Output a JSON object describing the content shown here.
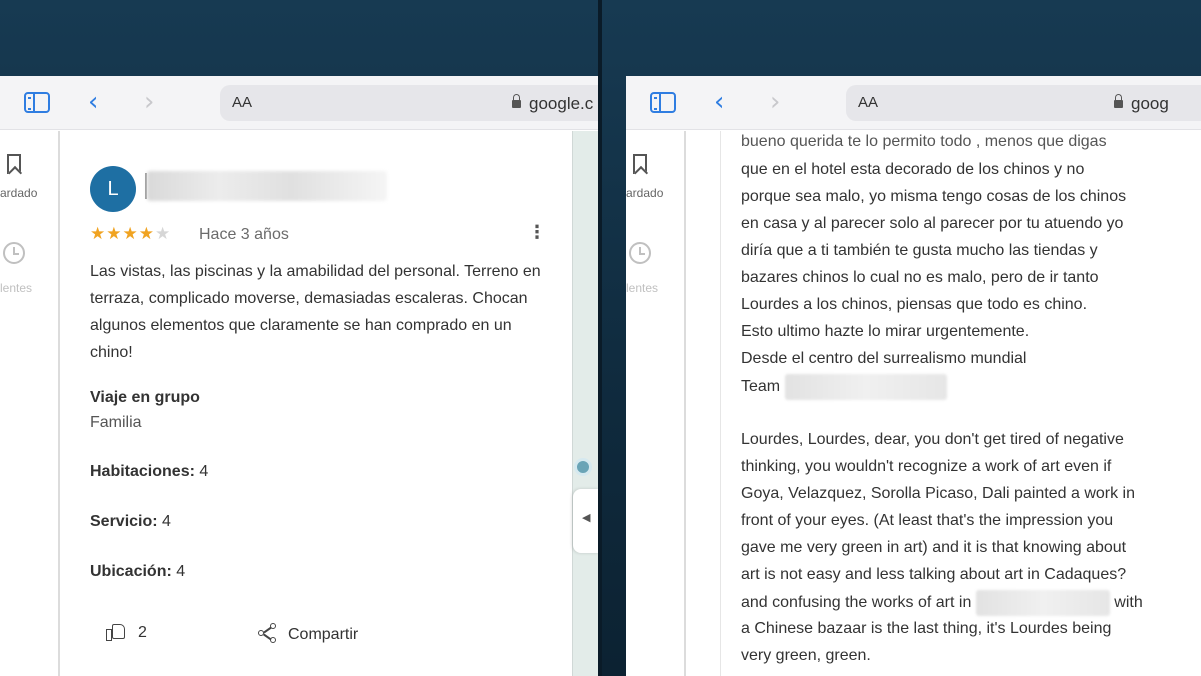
{
  "browser": {
    "text_size_label": "AA",
    "url": "google.c",
    "url_right": "goog"
  },
  "rail": {
    "saved_label": "ardado",
    "recents_label": "lentes"
  },
  "review": {
    "avatar_letter": "L",
    "rating": 4,
    "max_rating": 5,
    "date": "Hace 3 años",
    "text": "Las vistas, las piscinas y la amabilidad del personal. Terreno en terraza, complicado moverse, demasiadas escaleras. Chocan algunos elementos que claramente se han comprado en un chino!",
    "trip_type_label": "Viaje en grupo",
    "trip_type_value": "Familia",
    "rooms_label": "Habitaciones:",
    "rooms_value": "4",
    "service_label": "Servicio:",
    "service_value": "4",
    "location_label": "Ubicación:",
    "location_value": "4",
    "likes": "2",
    "share_label": "Compartir"
  },
  "reply": {
    "lines": [
      "bueno querida te lo permito todo , menos que digas",
      "que en el hotel esta decorado de los chinos y no",
      "porque sea malo, yo misma tengo cosas de los chinos",
      "en casa y al parecer solo al parecer por tu atuendo yo",
      "diría que a ti también te gusta mucho las tiendas y",
      "bazares chinos lo cual no es malo, pero de ir tanto",
      "Lourdes a los chinos, piensas que todo es chino.",
      "Esto ultimo  hazte lo mirar urgentemente.",
      "Desde el centro del surrealismo mundial",
      "Team",
      "Lourdes, Lourdes, dear, you don't get tired of negative",
      "thinking, you wouldn't recognize a work of art even if",
      "Goya, Velazquez, Sorolla Picaso, Dali painted a work in",
      "front of your eyes. (At least that's the impression you",
      "gave me very green in art) and it is that knowing about",
      "art is not easy and less talking about art in Cadaques?",
      "and confusing the works of art in",
      "with",
      "a Chinese bazaar is the last thing, it's Lourdes being",
      "very green, green."
    ]
  }
}
